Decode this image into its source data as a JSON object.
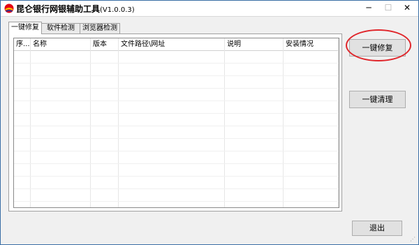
{
  "window": {
    "title": "昆仑银行网银辅助工具",
    "version": "(V1.0.0.3)",
    "minimize_glyph": "─",
    "maximize_glyph": "☐",
    "close_glyph": "✕"
  },
  "tabs": [
    {
      "label": "一键修复",
      "active": true
    },
    {
      "label": "软件检测",
      "active": false
    },
    {
      "label": "浏览器检测",
      "active": false
    }
  ],
  "table": {
    "columns": [
      "序...",
      "名称",
      "版本",
      "文件路径\\网址",
      "说明",
      "安装情况"
    ],
    "rows": []
  },
  "buttons": {
    "repair": "一键修复",
    "clean": "一键清理",
    "exit": "退出"
  },
  "icons": {
    "app": "kunlun-logo-icon",
    "grip": "resize-grip-icon"
  },
  "colors": {
    "highlight": "#e0262b",
    "window_border": "#3a6ea5"
  }
}
